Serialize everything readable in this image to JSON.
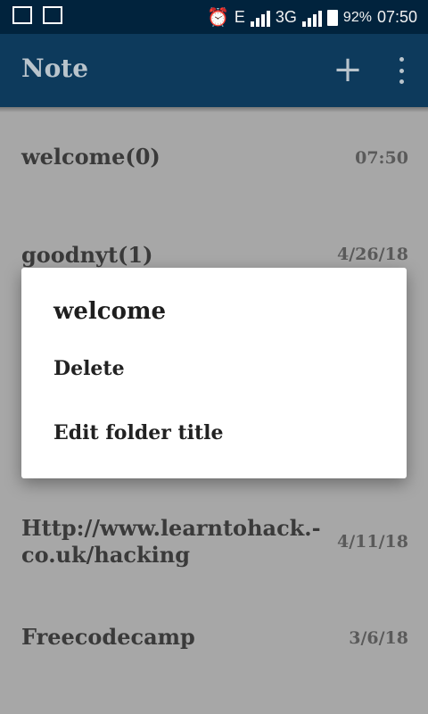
{
  "status_bar": {
    "network_e": "E",
    "network_3g": "3G",
    "battery": "92%",
    "time": "07:50"
  },
  "app_bar": {
    "title": "Note",
    "add_label": "+"
  },
  "notes": [
    {
      "title": "welcome(0)",
      "date": "07:50"
    },
    {
      "title": "goodnyt(1)",
      "date": "4/26/18"
    },
    {
      "title_line1": "Http://www.learntohack.-",
      "title_line2": "co.uk/hacking",
      "date": "4/11/18"
    },
    {
      "title": "Freecodecamp",
      "date": "3/6/18"
    }
  ],
  "dialog": {
    "title": "welcome",
    "items": [
      "Delete",
      "Edit folder title"
    ]
  }
}
